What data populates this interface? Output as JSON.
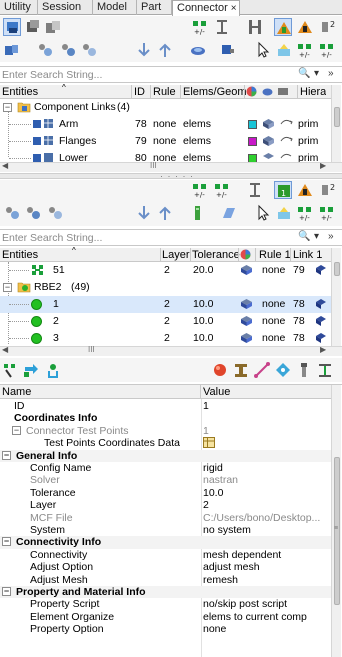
{
  "tabs": [
    {
      "label": "Utility",
      "active": false
    },
    {
      "label": "Session",
      "active": false
    },
    {
      "label": "Model",
      "active": false
    },
    {
      "label": "Part",
      "active": false
    },
    {
      "label": "Connector",
      "active": true
    }
  ],
  "tab_close": "×",
  "top_browser": {
    "search_placeholder": "Enter Search String...",
    "columns": [
      "Entities",
      "ID",
      "Rule",
      "Elems/Geom",
      "Hiera"
    ],
    "group": {
      "label": "Component Links",
      "count": "(4)"
    },
    "rows": [
      {
        "name": "Arm",
        "id": "78",
        "rule": "none",
        "elems": "elems",
        "color": "#19c4d6",
        "hier": "prim"
      },
      {
        "name": "Flanges",
        "id": "79",
        "rule": "none",
        "elems": "elems",
        "color": "#c819c8",
        "hier": "prim"
      },
      {
        "name": "Lower",
        "id": "80",
        "rule": "none",
        "elems": "elems",
        "color": "#2fd02f",
        "hier": "prim"
      }
    ],
    "hscroll_grip": "III"
  },
  "mid_browser": {
    "search_placeholder": "Enter Search String...",
    "columns": [
      "Entities",
      "Layer",
      "Tolerance",
      "Rule 1",
      "Link 1"
    ],
    "first_row": {
      "name": "51",
      "layer": "2",
      "tolerance": "20.0",
      "rule": "none",
      "link": "79"
    },
    "group": {
      "label": "RBE2",
      "count": "(49)"
    },
    "rows": [
      {
        "name": "1",
        "layer": "2",
        "tolerance": "10.0",
        "rule": "none",
        "link": "78",
        "selected": true
      },
      {
        "name": "2",
        "layer": "2",
        "tolerance": "10.0",
        "rule": "none",
        "link": "78",
        "selected": false
      },
      {
        "name": "3",
        "layer": "2",
        "tolerance": "10.0",
        "rule": "none",
        "link": "78",
        "selected": false
      }
    ],
    "hscroll_grip": "III"
  },
  "properties": {
    "header": {
      "name": "Name",
      "value": "Value"
    },
    "rows": [
      {
        "kind": "field",
        "name": "ID",
        "value": "1",
        "indent": 14,
        "gray": false
      },
      {
        "kind": "bold",
        "name": "Coordinates Info",
        "value": "",
        "indent": 14
      },
      {
        "kind": "section",
        "name": "Connector Test Points",
        "value": "1",
        "indent": 14,
        "gray": true
      },
      {
        "kind": "field",
        "name": "Test Points Coordinates Data",
        "value": "",
        "icon": "table-icon",
        "indent": 44,
        "gray": false
      },
      {
        "kind": "section",
        "name": "General Info",
        "value": "",
        "indent": 4
      },
      {
        "kind": "field",
        "name": "Config Name",
        "value": "rigid",
        "indent": 30,
        "gray": false
      },
      {
        "kind": "field",
        "name": "Solver",
        "value": "nastran",
        "indent": 30,
        "gray": true
      },
      {
        "kind": "field",
        "name": "Tolerance",
        "value": "10.0",
        "indent": 30,
        "gray": false
      },
      {
        "kind": "field",
        "name": "Layer",
        "value": "2",
        "indent": 30,
        "gray": false
      },
      {
        "kind": "field",
        "name": "MCF File",
        "value": "C:/Users/bono/Desktop...",
        "indent": 30,
        "gray": true
      },
      {
        "kind": "field",
        "name": "System",
        "value": "no system",
        "indent": 30,
        "gray": false
      },
      {
        "kind": "section",
        "name": "Connectivity Info",
        "value": "",
        "indent": 4
      },
      {
        "kind": "field",
        "name": "Connectivity",
        "value": "mesh dependent",
        "indent": 30,
        "gray": false
      },
      {
        "kind": "field",
        "name": "Adjust Option",
        "value": "adjust mesh",
        "indent": 30,
        "gray": false
      },
      {
        "kind": "field",
        "name": "Adjust Mesh",
        "value": "remesh",
        "indent": 30,
        "gray": false
      },
      {
        "kind": "section",
        "name": "Property and Material Info",
        "value": "",
        "indent": 4
      },
      {
        "kind": "field",
        "name": "Property Script",
        "value": "no/skip post script",
        "indent": 30,
        "gray": false
      },
      {
        "kind": "field",
        "name": "Element Organize",
        "value": "elems to current comp",
        "indent": 30,
        "gray": false
      },
      {
        "kind": "field",
        "name": "Property Option",
        "value": "none",
        "indent": 30,
        "gray": false
      }
    ]
  }
}
